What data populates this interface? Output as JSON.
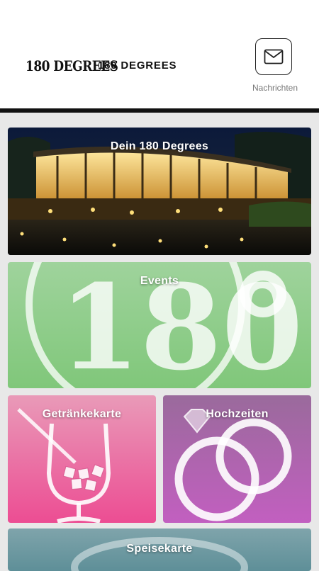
{
  "header": {
    "logo_text": "180 DEGREES",
    "title": "180 DEGREES",
    "messages_label": "Nachrichten",
    "messages_icon": "envelope-icon"
  },
  "tiles": [
    {
      "label": "Dein 180 Degrees",
      "image": "restaurant-photo"
    },
    {
      "label": "Events",
      "bg_color": "#8fcf8a",
      "watermark": "180°"
    },
    {
      "label": "Getränkekarte",
      "bg_color": "#e8549a",
      "icon": "wine-glass-icon"
    },
    {
      "label": "Hochzeiten",
      "bg_color": "#b56abf",
      "icon": "wedding-rings-icon"
    },
    {
      "label": "Speisekarte",
      "bg_color": "#6f9aa3",
      "icon": "plate-icon"
    }
  ]
}
